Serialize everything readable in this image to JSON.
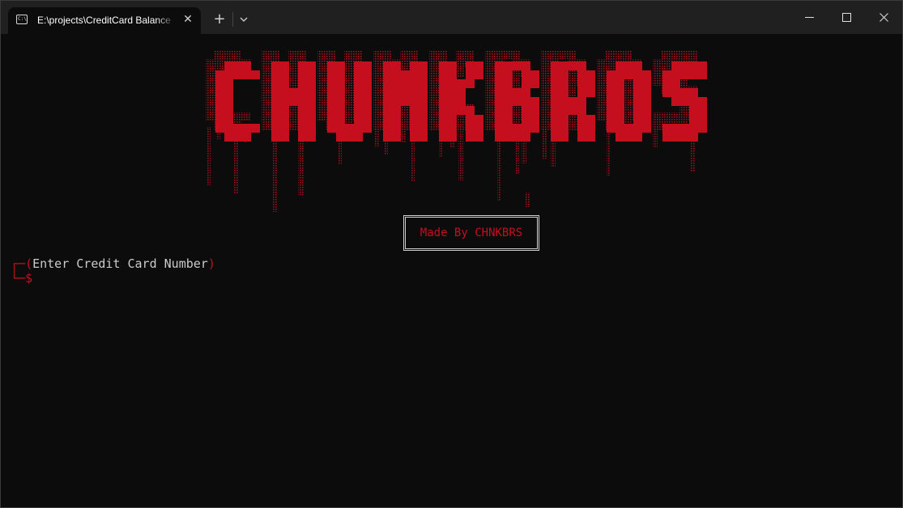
{
  "window": {
    "tab_title": "E:\\projects\\CreditCard Balance",
    "tab_icon": "terminal-icon",
    "new_tab_label": "+",
    "controls": [
      "minimize-icon",
      "maximize-icon",
      "close-icon"
    ]
  },
  "banner": {
    "text": "CHUNKBROS",
    "color": "#c50f1f"
  },
  "made_by": "Made By CHNKBRS",
  "prompt": {
    "open_paren": "(",
    "label": "Enter Credit Card Number",
    "close_paren": ")",
    "symbol": "$"
  },
  "colors": {
    "background": "#0c0c0c",
    "accent_red": "#c50f1f",
    "text": "#cccccc",
    "titlebar": "#202020"
  }
}
